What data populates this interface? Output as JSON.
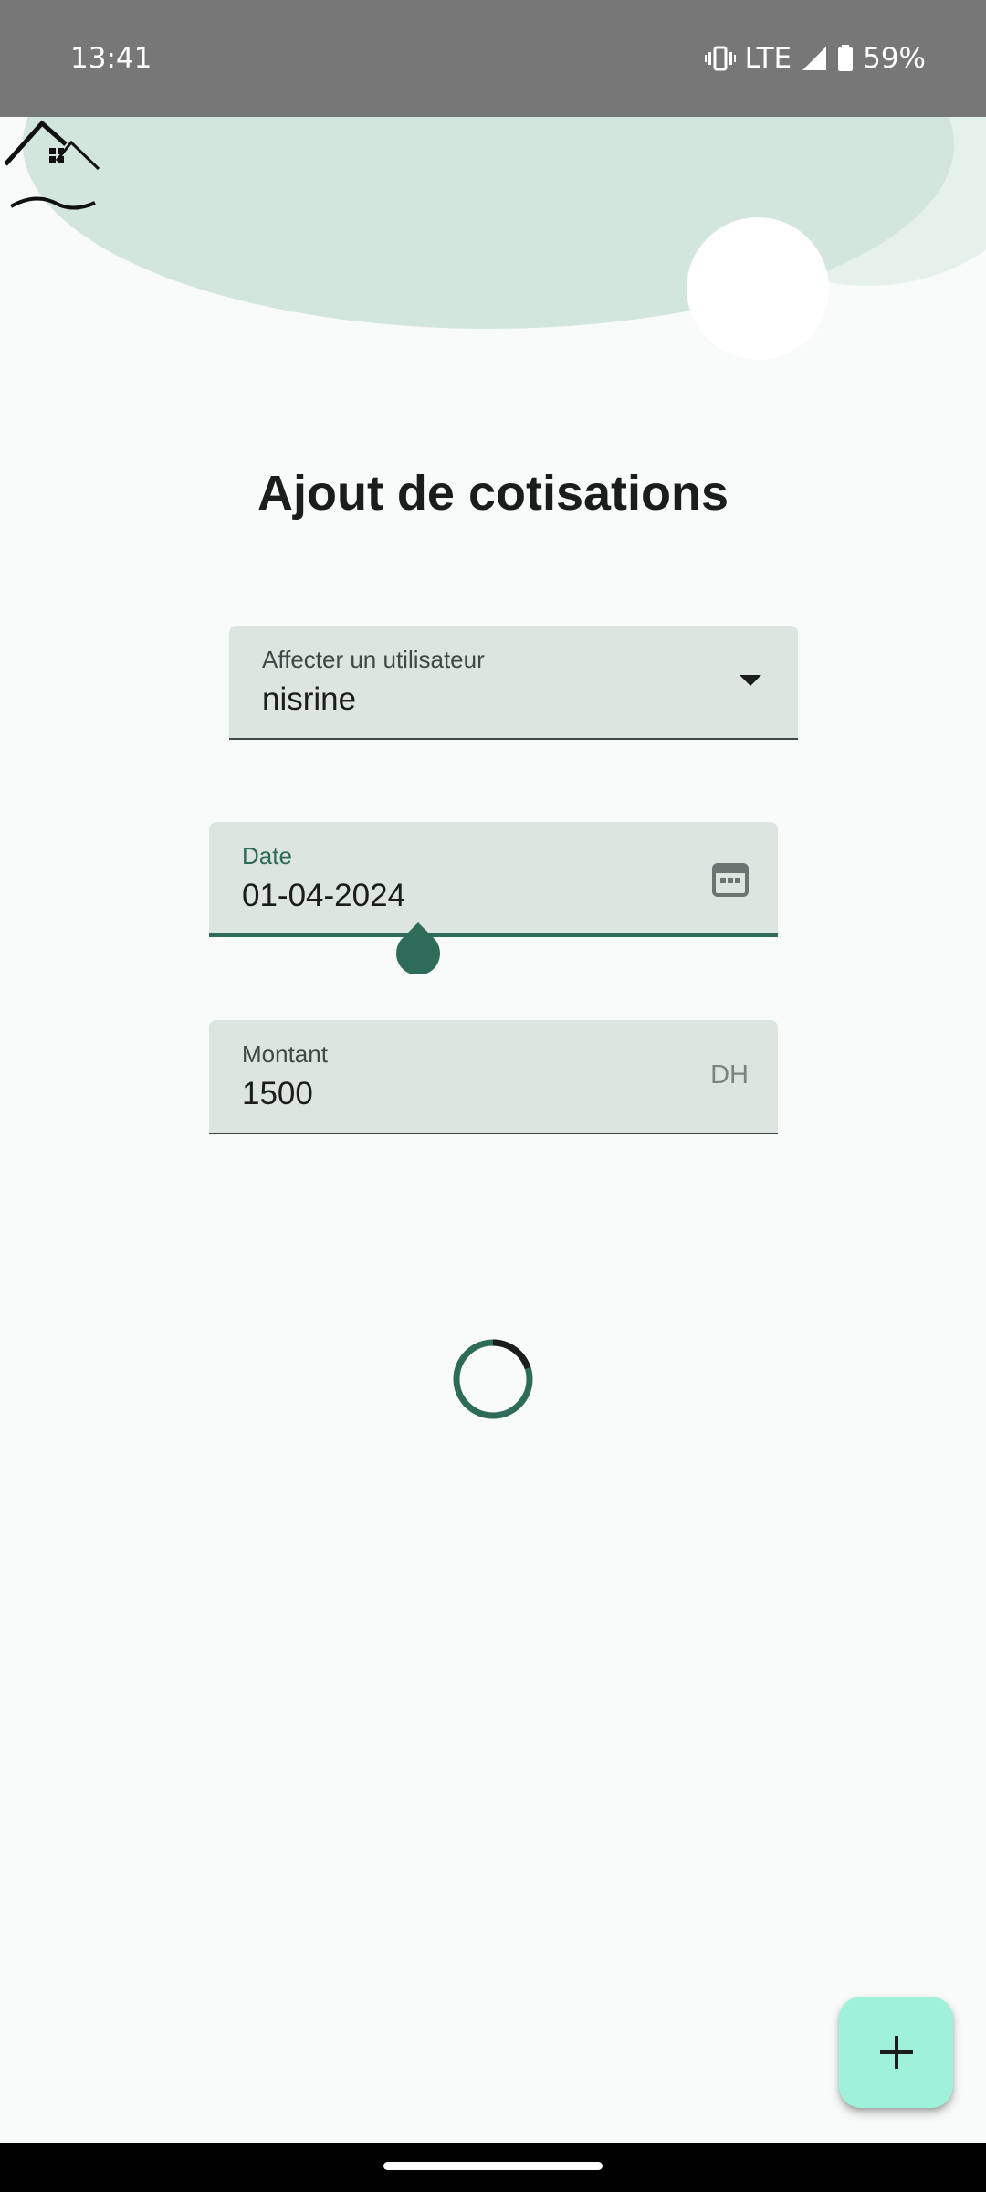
{
  "status_bar": {
    "time": "13:41",
    "network": "LTE",
    "battery": "59%",
    "icons": [
      "vibrate-icon",
      "signal-icon",
      "battery-icon"
    ]
  },
  "page": {
    "title": "Ajout de cotisations"
  },
  "form": {
    "user": {
      "label": "Affecter un utilisateur",
      "value": "nisrine"
    },
    "date": {
      "label": "Date",
      "value": "01-04-2024"
    },
    "amount": {
      "label": "Montant",
      "value": "1500",
      "suffix": "DH"
    }
  },
  "fab": {
    "icon": "plus-icon"
  },
  "colors": {
    "accent": "#2e6b58",
    "field_bg": "#dce5df",
    "fab_bg": "#9ff2d9",
    "decor": "#d2e6de",
    "background": "#f8fbf9"
  }
}
